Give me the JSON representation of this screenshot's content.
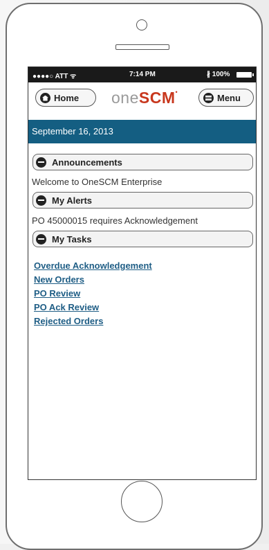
{
  "status_bar": {
    "carrier": "●●●●○ ATT ᯤ",
    "time": "7:14 PM",
    "battery": "∦ 100%"
  },
  "nav": {
    "home_label": "Home",
    "menu_label": "Menu",
    "brand_part1": "one",
    "brand_part2": "SCM",
    "brand_mark": "•"
  },
  "date_bar": "September 16, 2013",
  "sections": [
    {
      "title": "Announcements",
      "content": "Welcome to OneSCM Enterprise"
    },
    {
      "title": "My Alerts",
      "content": "PO 45000015 requires Acknowledgement"
    },
    {
      "title": "My Tasks"
    }
  ],
  "tasks": [
    "Overdue Acknowledgement",
    "New Orders",
    "PO Review",
    "PO Ack Review",
    "Rejected Orders"
  ],
  "colors": {
    "date_bar_bg": "#145e82",
    "link": "#1e5d85",
    "brand_accent": "#c8371d",
    "brand_gray": "#9a9a9a"
  }
}
